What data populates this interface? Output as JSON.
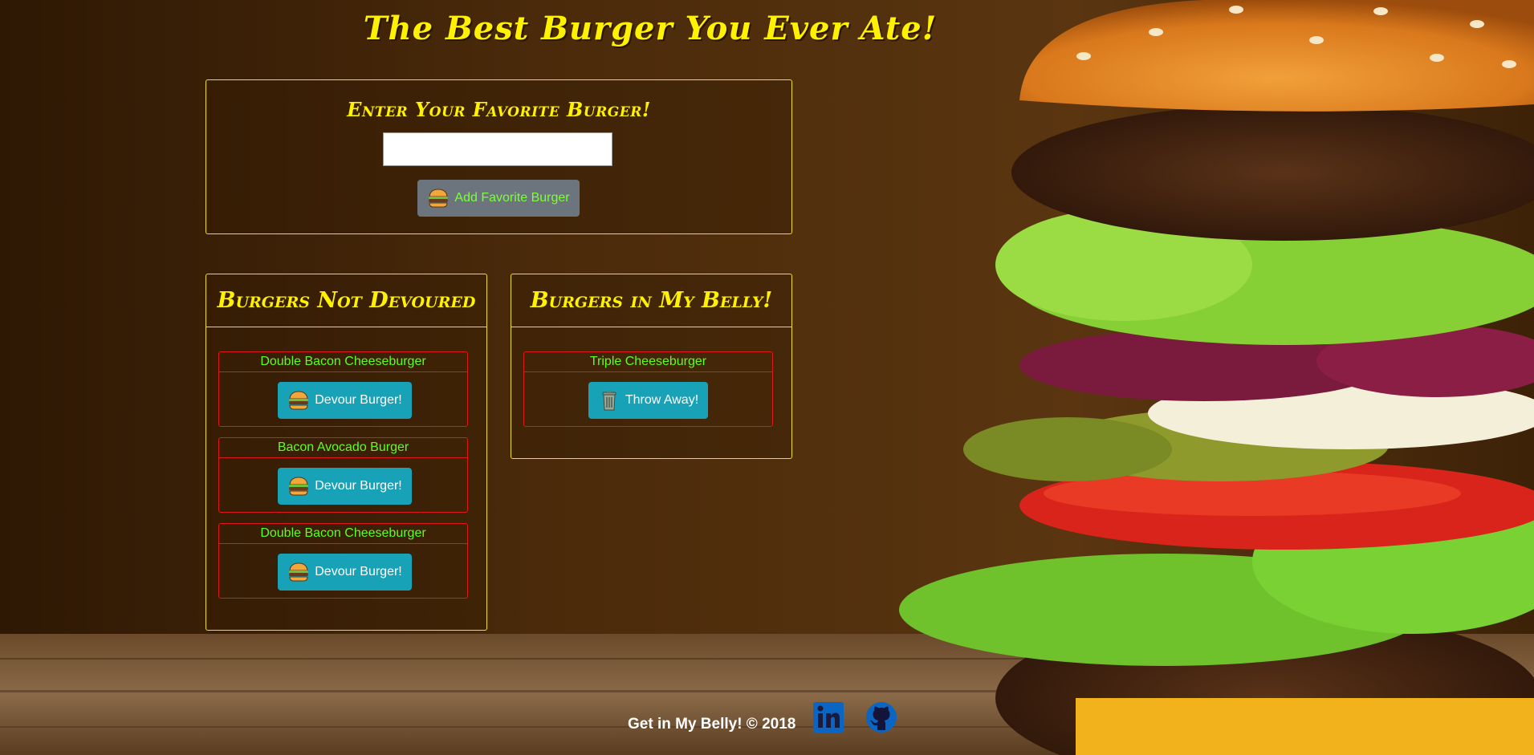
{
  "header": {
    "title": "The Best Burger You Ever Ate!"
  },
  "add_form": {
    "heading": "Enter Your Favorite Burger!",
    "input_value": "",
    "button_label": "Add Favorite Burger"
  },
  "not_devoured": {
    "heading": "Burgers Not Devoured",
    "items": [
      {
        "name": "Double Bacon Cheeseburger",
        "button_label": "Devour Burger!"
      },
      {
        "name": "Bacon Avocado Burger",
        "button_label": "Devour Burger!"
      },
      {
        "name": "Double Bacon Cheeseburger",
        "button_label": "Devour Burger!"
      }
    ]
  },
  "devoured": {
    "heading": "Burgers in My Belly!",
    "items": [
      {
        "name": "Triple Cheeseburger",
        "button_label": "Throw Away!"
      }
    ]
  },
  "footer": {
    "text": "Get in My Belly! © 2018",
    "icons": [
      "linkedin-icon",
      "github-icon"
    ]
  },
  "colors": {
    "title": "#fff200",
    "panel_border": "#f2df1a",
    "card_border": "#e01818",
    "item_text": "#5cff1e",
    "primary_button": "#17a2b8",
    "secondary_button": "#6c757d",
    "social_icon": "#0a66c2"
  }
}
